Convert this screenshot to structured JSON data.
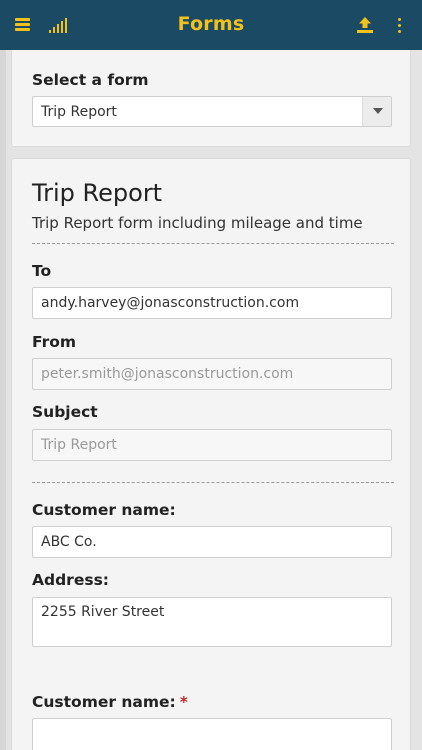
{
  "header": {
    "title": "Forms",
    "menu_icon": "hamburger-menu-icon",
    "signal_icon": "signal-bars-icon",
    "upload_icon": "upload-icon",
    "more_icon": "more-vertical-icon",
    "accent_color": "#f2c21b",
    "bar_color": "#1b4a64"
  },
  "form_selector": {
    "label": "Select a form",
    "selected": "Trip Report"
  },
  "form": {
    "title": "Trip Report",
    "description": "Trip Report form including mileage and time",
    "to": {
      "label": "To",
      "value": "andy.harvey@jonasconstruction.com"
    },
    "from": {
      "label": "From",
      "value": "peter.smith@jonasconstruction.com"
    },
    "subject": {
      "label": "Subject",
      "value": "Trip Report"
    },
    "customer_name": {
      "label": "Customer name:",
      "value": "ABC Co."
    },
    "address": {
      "label": "Address:",
      "value": "2255 River Street"
    },
    "customer_name_required": {
      "label": "Customer name:",
      "required_marker": "*",
      "value": ""
    }
  }
}
